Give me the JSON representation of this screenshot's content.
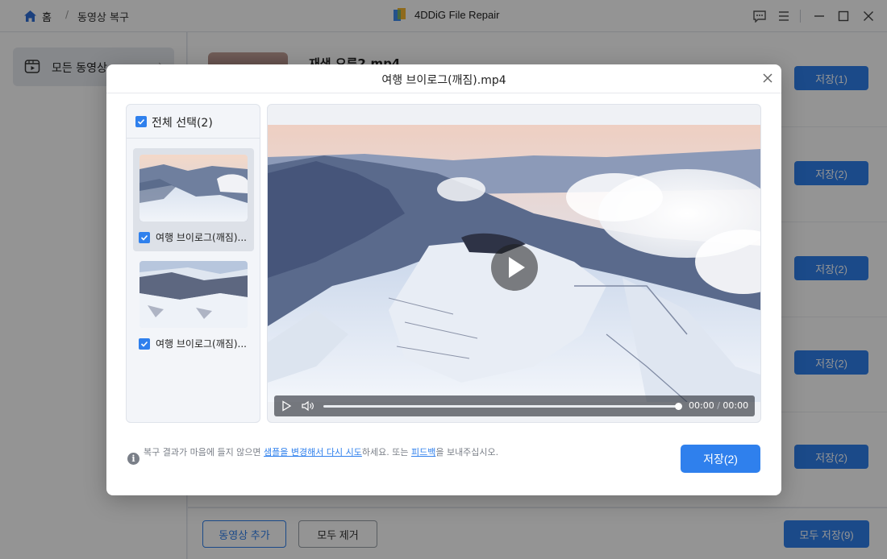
{
  "app": {
    "title": "4DDiG File Repair",
    "breadcrumb_home": "홈",
    "breadcrumb_separator": "/",
    "breadcrumb_page": "동영상 복구"
  },
  "sidebar": {
    "items": [
      {
        "label": "모든 동영상",
        "icon": "video-library-icon"
      }
    ]
  },
  "main": {
    "rows": [
      {
        "name": "재생 오류2.mp4",
        "save_label": "저장(1)"
      },
      {
        "name": "",
        "save_label": "저장(2)"
      },
      {
        "name": "",
        "save_label": "저장(2)"
      },
      {
        "name": "",
        "save_label": "저장(2)"
      },
      {
        "name": "",
        "save_label": "저장(2)"
      }
    ]
  },
  "footer": {
    "add_label": "동영상 추가",
    "remove_label": "모두 제거",
    "save_all_label": "모두 저장(9)"
  },
  "modal": {
    "title": "여행 브이로그(깨짐).mp4",
    "select_all_label": "전체 선택(2)",
    "clips": [
      {
        "name": "여행 브이로그(깨짐)...",
        "checked": true,
        "active": true
      },
      {
        "name": "여행 브이로그(깨짐)...",
        "checked": true,
        "active": false
      }
    ],
    "player": {
      "current_time": "00:00",
      "time_separator": "/",
      "duration": "00:00",
      "progress": 1.0
    },
    "note": {
      "prefix": "복구 결과가 마음에 들지 않으면 ",
      "link1": "샘플을 변경해서 다시 시도",
      "middle": "하세요. 또는 ",
      "link2": "피드백",
      "suffix": "을 보내주십시오."
    },
    "save_label": "저장(2)"
  },
  "colors": {
    "accent": "#2f80ed",
    "overlay": "rgba(0,0,0,0.42)"
  }
}
